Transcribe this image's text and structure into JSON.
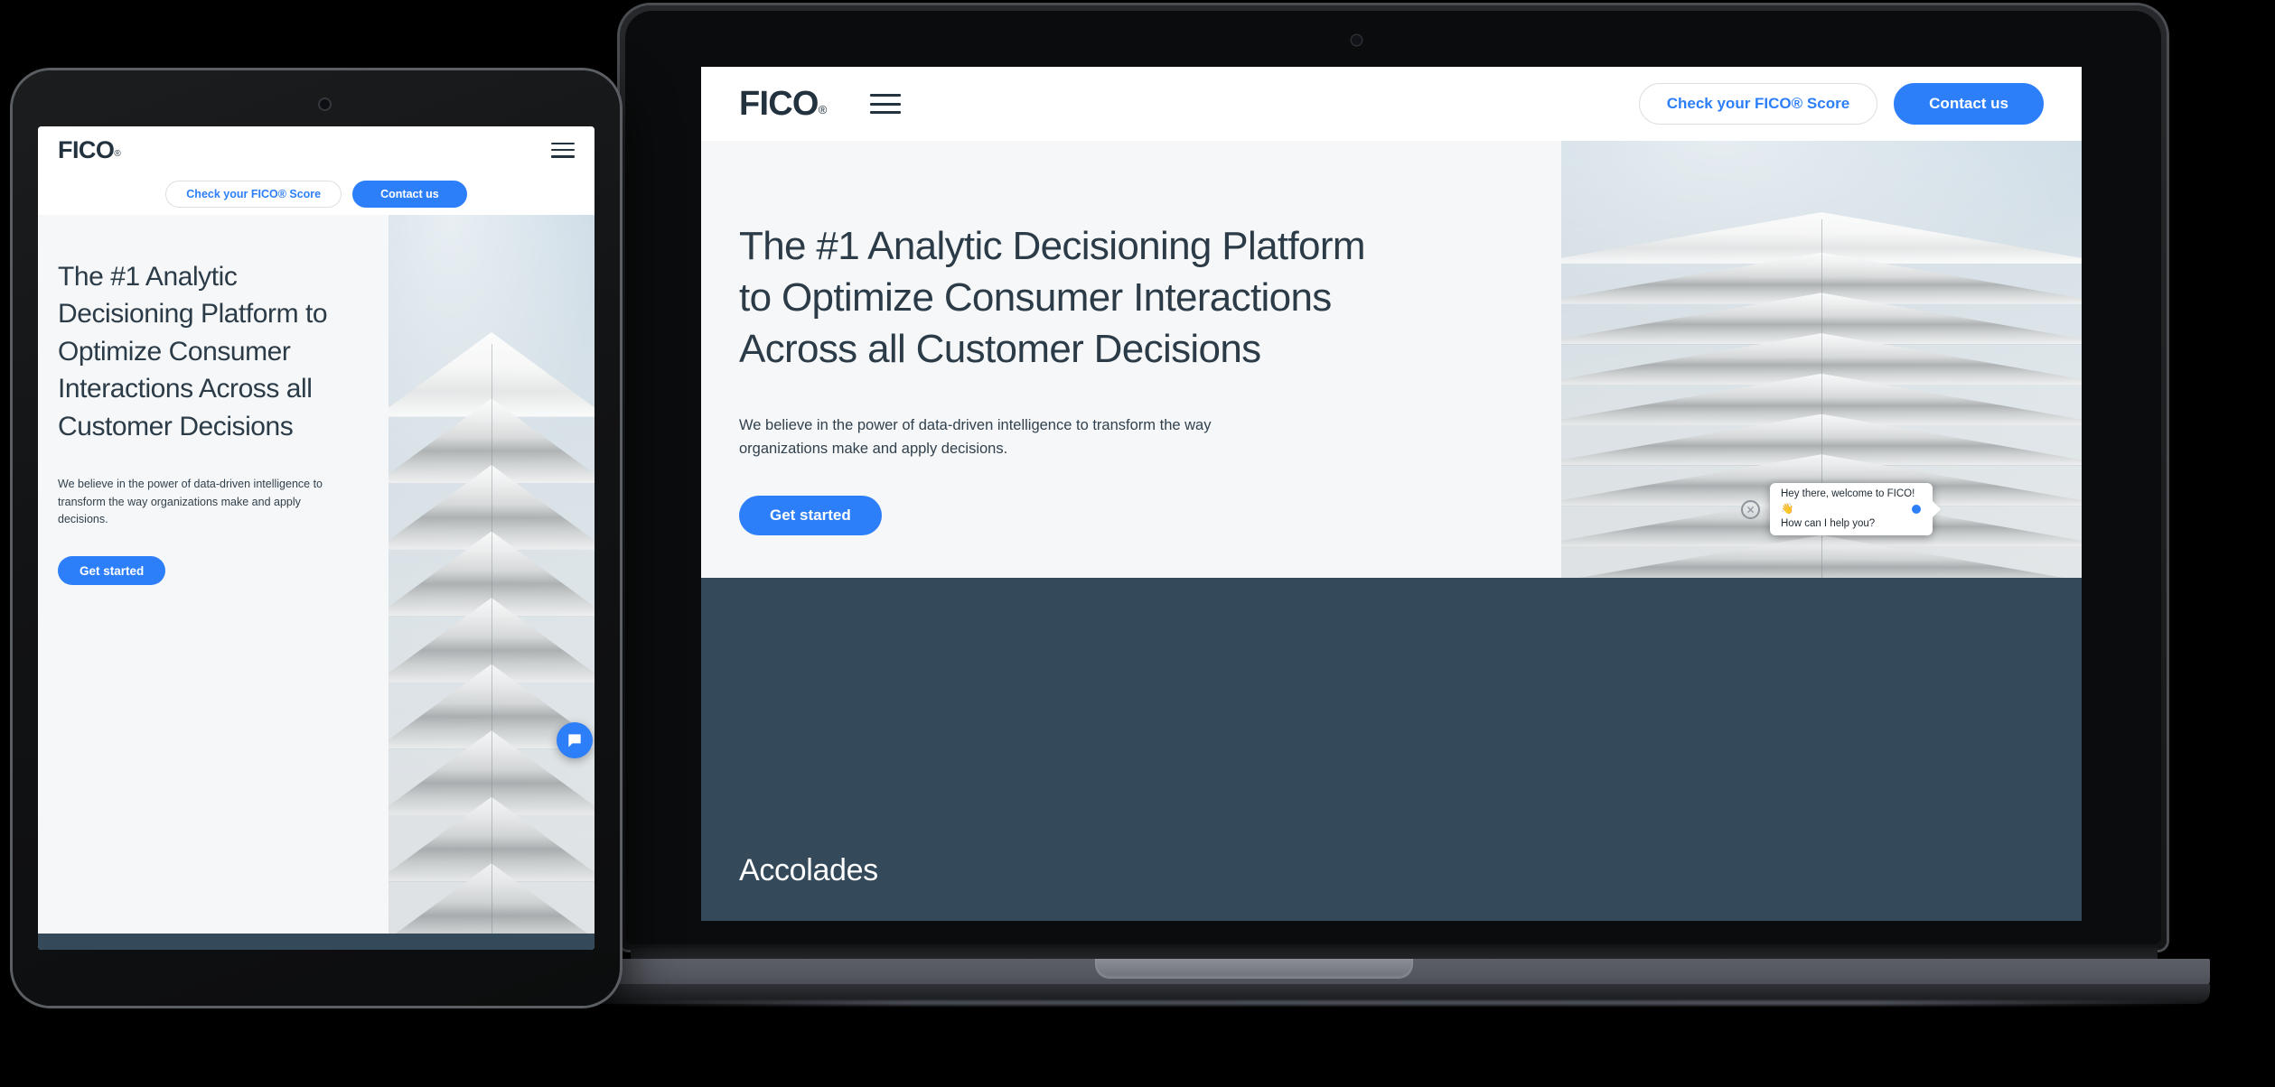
{
  "brand": {
    "logo_text": "FICO",
    "logo_registered": "®",
    "accent_blue": "#2d7ff9",
    "navy": "#23323f",
    "band_slate": "#34495a",
    "page_bg": "#f6f7f8"
  },
  "header": {
    "menu_icon": "hamburger-menu-icon",
    "check_score_label": "Check your FICO® Score",
    "contact_label": "Contact us"
  },
  "hero": {
    "heading": "The #1 Analytic Decisioning Platform to Optimize Consumer Interactions Across all Customer Decisions",
    "paragraph": "We believe in the power of data-driven intelligence to transform the way organizations make and apply decisions.",
    "cta_label": "Get started",
    "image_alt": "white-layered-modern-building-against-pale-blue-sky"
  },
  "band": {
    "title": "Accolades"
  },
  "chat": {
    "message_line1": "Hey there, welcome to FICO! 👋",
    "message_line2": "How can I help you?",
    "close_icon": "close-x-icon",
    "launcher_icon": "chat-bubble-icon",
    "close_glyph": "✕"
  },
  "devices": {
    "laptop_name": "laptop-device-mockup",
    "tablet_name": "tablet-device-mockup"
  }
}
